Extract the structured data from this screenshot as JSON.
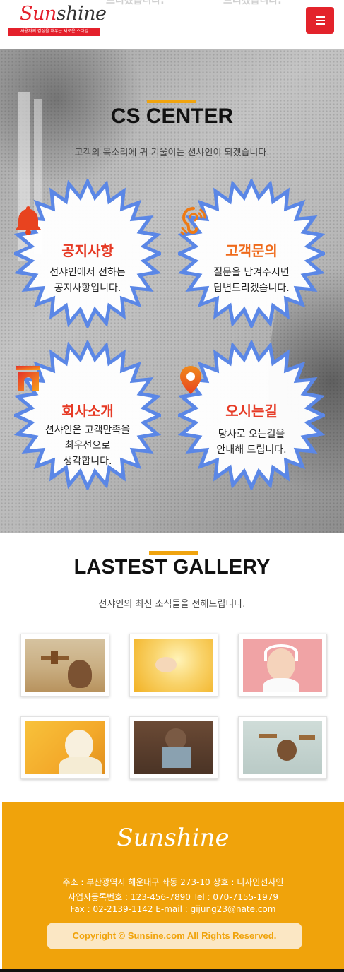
{
  "header": {
    "ghost_text_1": "드리겠습니다.",
    "ghost_text_2": "드리겠습니다.",
    "logo_prefix": "Sun",
    "logo_suffix": "shine",
    "logo_tagline": "사용자의 감성을 채우는 새로운 스타일",
    "menu_icon": "hamburger-icon"
  },
  "cs_center": {
    "title": "CS CENTER",
    "subtitle": "고객의 목소리에 귀 기울이는 션샤인이 되겠습니다.",
    "cards": [
      {
        "icon": "bell-icon",
        "title": "공지사항",
        "desc_1": "선샤인에서 전하는",
        "desc_2": "공지사항입니다."
      },
      {
        "icon": "ear-icon",
        "title": "고객문의",
        "desc_1": "질문을 남겨주시면",
        "desc_2": "답변드리겠습니다."
      },
      {
        "icon": "building-icon",
        "title": "회사소개",
        "desc_1": "션샤인은 고객만족을",
        "desc_2": "최우선으로",
        "desc_3": "생각합니다."
      },
      {
        "icon": "map-pin-icon",
        "title": "오시는길",
        "desc_1": "당사로 오는길을",
        "desc_2": "안내해 드립니다."
      }
    ]
  },
  "gallery": {
    "title": "LASTEST GALLERY",
    "subtitle": "선샤인의 최신 소식들을 전해드립니다.",
    "images": [
      "child-airplane-photo",
      "baby-hand-photo",
      "baby-headphones-photo",
      "baby-feeding-photo",
      "pilot-kid-photo",
      "kid-toy-plane-photo"
    ]
  },
  "footer": {
    "logo": "Sunshine",
    "address_line": "주소 : 부산광역시 해운대구 좌동 273-10    상호 : 디자인선사인",
    "business_line": "사업자등록번호 : 123-456-7890    Tel : 070-7155-1979",
    "contact_line": "Fax : 02-2139-1142    E-mail : gijung23@nate.com",
    "copyright": "Copyright © Sunsine.com All Rights Reserved."
  },
  "colors": {
    "brand_red": "#e3232b",
    "accent_orange": "#f0a30b",
    "badge_border": "#5b87e6",
    "badge_title": "#e63a25"
  }
}
